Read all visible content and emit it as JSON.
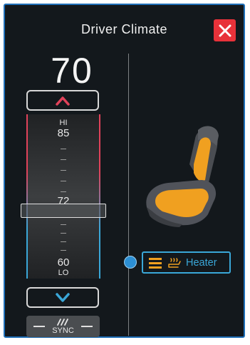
{
  "window": {
    "title": "Driver Climate"
  },
  "temperature": {
    "current": "70"
  },
  "scale": {
    "hi_label": "HI",
    "top_value": "85",
    "selected_value": "72",
    "bottom_value": "60",
    "lo_label": "LO"
  },
  "sync": {
    "label": "SYNC"
  },
  "heater": {
    "label": "Heater",
    "level": 3
  },
  "colors": {
    "accent": "#3aa7d8",
    "heat": "#f0a020",
    "close": "#e8323a",
    "up_arrow": "#e0425a",
    "down_arrow": "#3aa7d8"
  },
  "icons": [
    "close-icon",
    "chevron-up-icon",
    "chevron-down-icon",
    "fan-icon",
    "heat-level-icon",
    "seat-heat-icon",
    "car-seat-icon"
  ]
}
